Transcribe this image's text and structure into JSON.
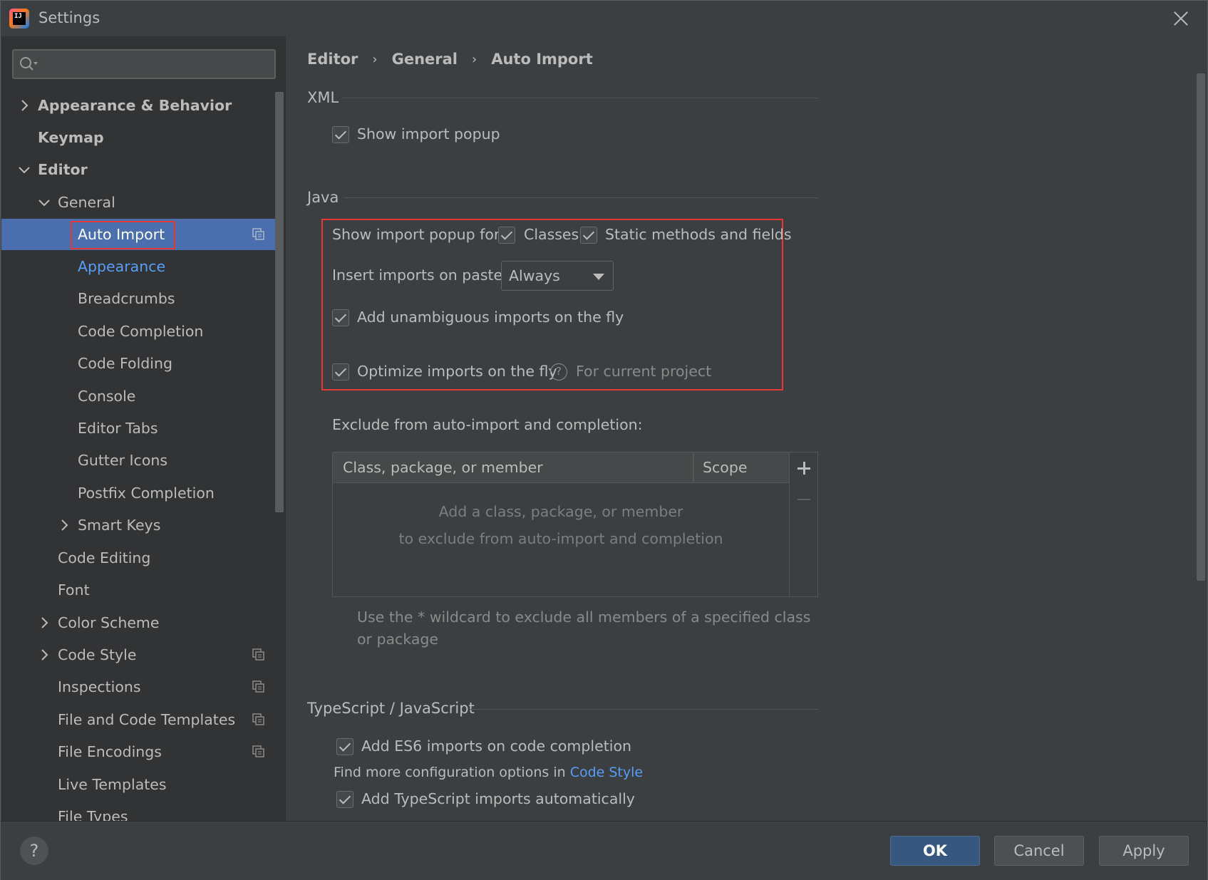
{
  "window": {
    "title": "Settings",
    "app_logo_text": "IJ"
  },
  "search": {
    "placeholder": ""
  },
  "sidebar": {
    "items": [
      {
        "label": "Appearance & Behavior"
      },
      {
        "label": "Keymap"
      },
      {
        "label": "Editor"
      },
      {
        "label": "General"
      },
      {
        "label": "Auto Import"
      },
      {
        "label": "Appearance"
      },
      {
        "label": "Breadcrumbs"
      },
      {
        "label": "Code Completion"
      },
      {
        "label": "Code Folding"
      },
      {
        "label": "Console"
      },
      {
        "label": "Editor Tabs"
      },
      {
        "label": "Gutter Icons"
      },
      {
        "label": "Postfix Completion"
      },
      {
        "label": "Smart Keys"
      },
      {
        "label": "Code Editing"
      },
      {
        "label": "Font"
      },
      {
        "label": "Color Scheme"
      },
      {
        "label": "Code Style"
      },
      {
        "label": "Inspections"
      },
      {
        "label": "File and Code Templates"
      },
      {
        "label": "File Encodings"
      },
      {
        "label": "Live Templates"
      },
      {
        "label": "File Types"
      }
    ]
  },
  "breadcrumb": {
    "items": [
      "Editor",
      "General",
      "Auto Import"
    ],
    "separator": "›"
  },
  "xml": {
    "title": "XML",
    "show_import_popup": "Show import popup"
  },
  "java": {
    "title": "Java",
    "show_import_popup_for": "Show import popup for:",
    "classes": "Classes",
    "static_methods": "Static methods and fields",
    "insert_imports_on_paste": "Insert imports on paste:",
    "insert_imports_value": "Always",
    "add_unambiguous": "Add unambiguous imports on the fly",
    "optimize_imports": "Optimize imports on the fly",
    "help_glyph": "?",
    "for_current_project": "For current project",
    "exclude_label": "Exclude from auto-import and completion:",
    "table": {
      "columns": [
        "Class, package, or member",
        "Scope"
      ],
      "empty_line1": "Add a class, package, or member",
      "empty_line2": "to exclude from auto-import and completion"
    },
    "wildcard_note": "Use the * wildcard to exclude all members of a specified class or package"
  },
  "typescript": {
    "title": "TypeScript / JavaScript",
    "add_es6": "Add ES6 imports on code completion",
    "find_more_prefix": "Find more configuration options in ",
    "code_style_link": "Code Style",
    "add_ts_imports": "Add TypeScript imports automatically"
  },
  "footer": {
    "help": "?",
    "ok": "OK",
    "cancel": "Cancel",
    "apply": "Apply"
  },
  "colors": {
    "selection": "#4b6eaf",
    "link": "#589df6",
    "highlight": "#e53935",
    "primary_button": "#365880"
  }
}
